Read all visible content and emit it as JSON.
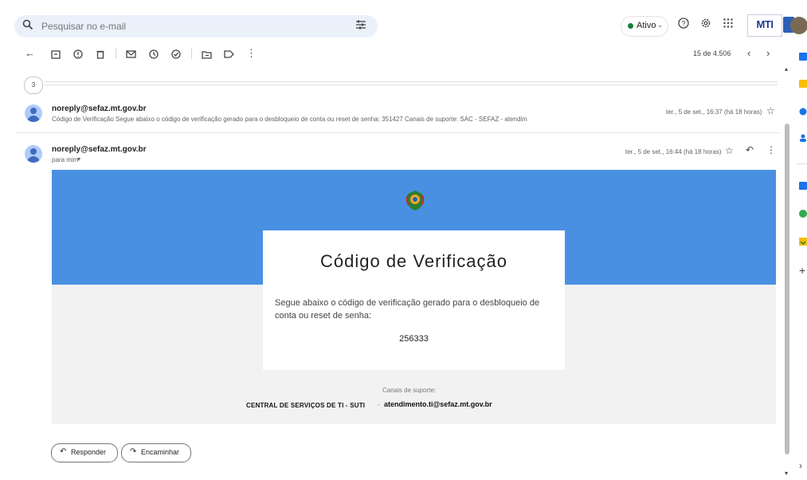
{
  "search": {
    "placeholder": "Pesquisar no e-mail"
  },
  "status": {
    "label": "Ativo",
    "color": "#188038"
  },
  "header": {
    "logo_text": "MTI"
  },
  "toolbar": {
    "page_count": "15 de 4.506"
  },
  "thread": {
    "collapsed_count": "3",
    "messages": [
      {
        "sender": "noreply@sefaz.mt.gov.br",
        "snippet": "Código de Verificação Segue abaixo o código de verificação gerado para o desbloqueio de conta ou reset de senha: 351427 Canais de suporte: SAC - SEFAZ - atendim",
        "time": "ter., 5 de set., 16:37 (há 18 horas)"
      },
      {
        "sender": "noreply@sefaz.mt.gov.br",
        "recipient": "para mim",
        "time": "ter., 5 de set., 16:44 (há 18 horas)"
      }
    ]
  },
  "email": {
    "banner_color": "#4a90e2",
    "title": "Código de Verificação",
    "text": "Segue abaixo o código de verificação gerado para o desbloqueio de conta ou reset de senha:",
    "code": "256333",
    "support_label": "Canais de suporte:",
    "central": "CENTRAL DE SERVIÇOS DE TI - SUTI",
    "separator": "-",
    "support_email": "atendimento.ti@sefaz.mt.gov.br"
  },
  "actions": {
    "reply": "Responder",
    "forward": "Encaminhar"
  }
}
